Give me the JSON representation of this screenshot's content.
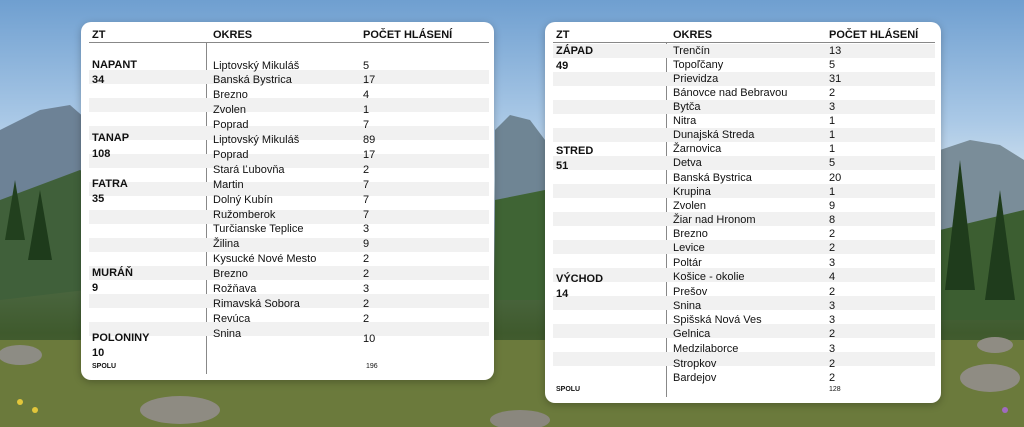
{
  "headers": {
    "zt": "ZT",
    "okres": "OKRES",
    "pocet": "POČET HLÁSENÍ"
  },
  "table1": {
    "groups": [
      {
        "name": "NAPANT",
        "count": "34"
      },
      {
        "name": "TANAP",
        "count": "108"
      },
      {
        "name": "FATRA",
        "count": "35"
      },
      {
        "name": "MURÁŇ",
        "count": "9"
      },
      {
        "name": "POLONINY",
        "count": "10"
      }
    ],
    "rows": [
      {
        "okres": "Liptovský Mikuláš",
        "pocet": "5"
      },
      {
        "okres": "Banská Bystrica",
        "pocet": "17"
      },
      {
        "okres": "Brezno",
        "pocet": "4"
      },
      {
        "okres": "Zvolen",
        "pocet": "1"
      },
      {
        "okres": "Poprad",
        "pocet": "7"
      },
      {
        "okres": "Liptovský Mikuláš",
        "pocet": "89"
      },
      {
        "okres": "Poprad",
        "pocet": "17"
      },
      {
        "okres": "Stará Ľubovňa",
        "pocet": "2"
      },
      {
        "okres": "Martin",
        "pocet": "7"
      },
      {
        "okres": "Dolný Kubín",
        "pocet": "7"
      },
      {
        "okres": "Ružomberok",
        "pocet": "7"
      },
      {
        "okres": "Turčianske Teplice",
        "pocet": "3"
      },
      {
        "okres": "Žilina",
        "pocet": "9"
      },
      {
        "okres": "Kysucké Nové Mesto",
        "pocet": "2"
      },
      {
        "okres": "Brezno",
        "pocet": "2"
      },
      {
        "okres": "Rožňava",
        "pocet": "3"
      },
      {
        "okres": "Rimavská Sobora",
        "pocet": "2"
      },
      {
        "okres": "Revúca",
        "pocet": "2"
      },
      {
        "okres": "Snina",
        "pocet": "10"
      }
    ],
    "total_label": "SPOLU",
    "total_value": "196"
  },
  "table2": {
    "groups": [
      {
        "name": "ZÁPAD",
        "count": "49"
      },
      {
        "name": "STRED",
        "count": "51"
      },
      {
        "name": "VÝCHOD",
        "count": "14"
      }
    ],
    "rows": [
      {
        "okres": "Trenčín",
        "pocet": "13"
      },
      {
        "okres": "Topoľčany",
        "pocet": "5"
      },
      {
        "okres": "Prievidza",
        "pocet": "31"
      },
      {
        "okres": "Bánovce nad Bebravou",
        "pocet": "2"
      },
      {
        "okres": "Bytča",
        "pocet": "3"
      },
      {
        "okres": "Nitra",
        "pocet": "1"
      },
      {
        "okres": "Dunajská Streda",
        "pocet": "1"
      },
      {
        "okres": "Žarnovica",
        "pocet": "1"
      },
      {
        "okres": "Detva",
        "pocet": "5"
      },
      {
        "okres": "Banská Bystrica",
        "pocet": "20"
      },
      {
        "okres": "Krupina",
        "pocet": "1"
      },
      {
        "okres": "Zvolen",
        "pocet": "9"
      },
      {
        "okres": "Žiar nad Hronom",
        "pocet": "8"
      },
      {
        "okres": "Brezno",
        "pocet": "2"
      },
      {
        "okres": "Levice",
        "pocet": "2"
      },
      {
        "okres": "Poltár",
        "pocet": "3"
      },
      {
        "okres": "Košice - okolie",
        "pocet": "4"
      },
      {
        "okres": "Prešov",
        "pocet": "2"
      },
      {
        "okres": "Snina",
        "pocet": "3"
      },
      {
        "okres": "Spišská Nová Ves",
        "pocet": "3"
      },
      {
        "okres": "Gelnica",
        "pocet": "2"
      },
      {
        "okres": "Medzilaborce",
        "pocet": "3"
      },
      {
        "okres": "Stropkov",
        "pocet": "2"
      },
      {
        "okres": "Bardejov",
        "pocet": "2"
      }
    ],
    "total_label": "SPOLU",
    "total_value": "128"
  }
}
